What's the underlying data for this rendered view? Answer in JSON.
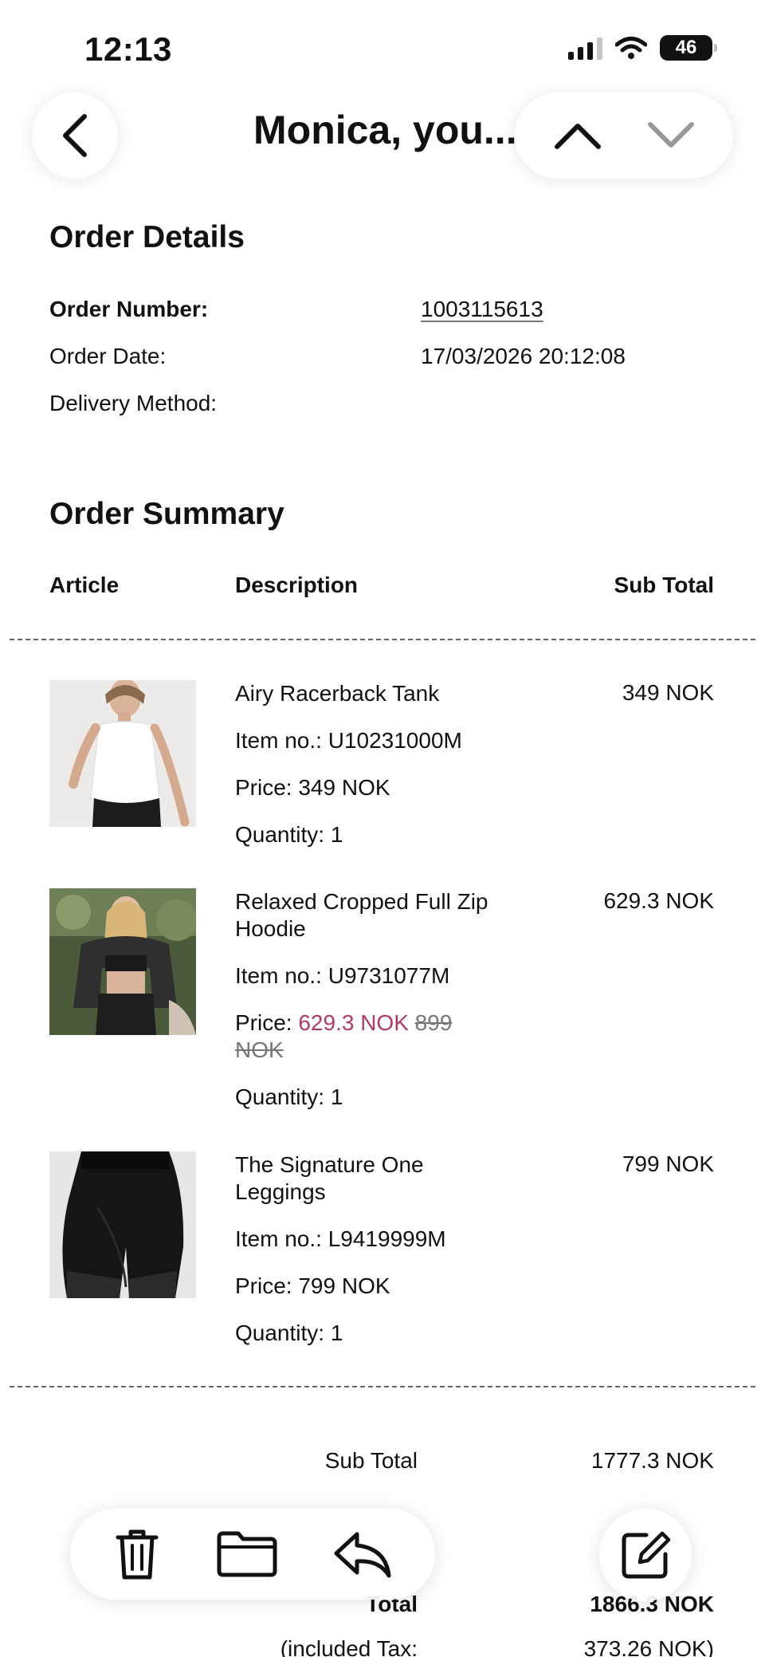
{
  "status_bar": {
    "time": "12:13",
    "battery": "46"
  },
  "header": {
    "title": "Monica, you..."
  },
  "order_details": {
    "title": "Order Details",
    "order_number_label": "Order Number:",
    "order_number": "1003115613",
    "order_date_label": "Order Date:",
    "order_date": "17/03/2026 20:12:08",
    "delivery_method_label": "Delivery Method:"
  },
  "order_summary": {
    "title": "Order Summary",
    "columns": {
      "article": "Article",
      "description": "Description",
      "sub_total": "Sub Total"
    },
    "items": [
      {
        "name": "Airy Racerback Tank",
        "item_no": "Item no.: U10231000M",
        "price_label": "Price: 349 NOK",
        "quantity": "Quantity: 1",
        "sub_total": "349 NOK"
      },
      {
        "name": "Relaxed Cropped Full Zip Hoodie",
        "item_no": "Item no.: U9731077M",
        "price_prefix": "Price:",
        "price_sale": "629.3 NOK",
        "price_original": "899 NOK",
        "quantity": "Quantity: 1",
        "sub_total": "629.3 NOK"
      },
      {
        "name": "The Signature One Leggings",
        "item_no": "Item no.: L9419999M",
        "price_label": "Price: 799 NOK",
        "quantity": "Quantity: 1",
        "sub_total": "799 NOK"
      }
    ]
  },
  "totals": {
    "sub_total_label": "Sub Total",
    "sub_total_value": "1777.3 NOK",
    "total_label": "Total",
    "total_value": "1866.3 NOK",
    "tax_label": "(included Tax:",
    "tax_value": "373.26 NOK)"
  },
  "colors": {
    "sale": "#b03a66",
    "text": "#111111"
  }
}
